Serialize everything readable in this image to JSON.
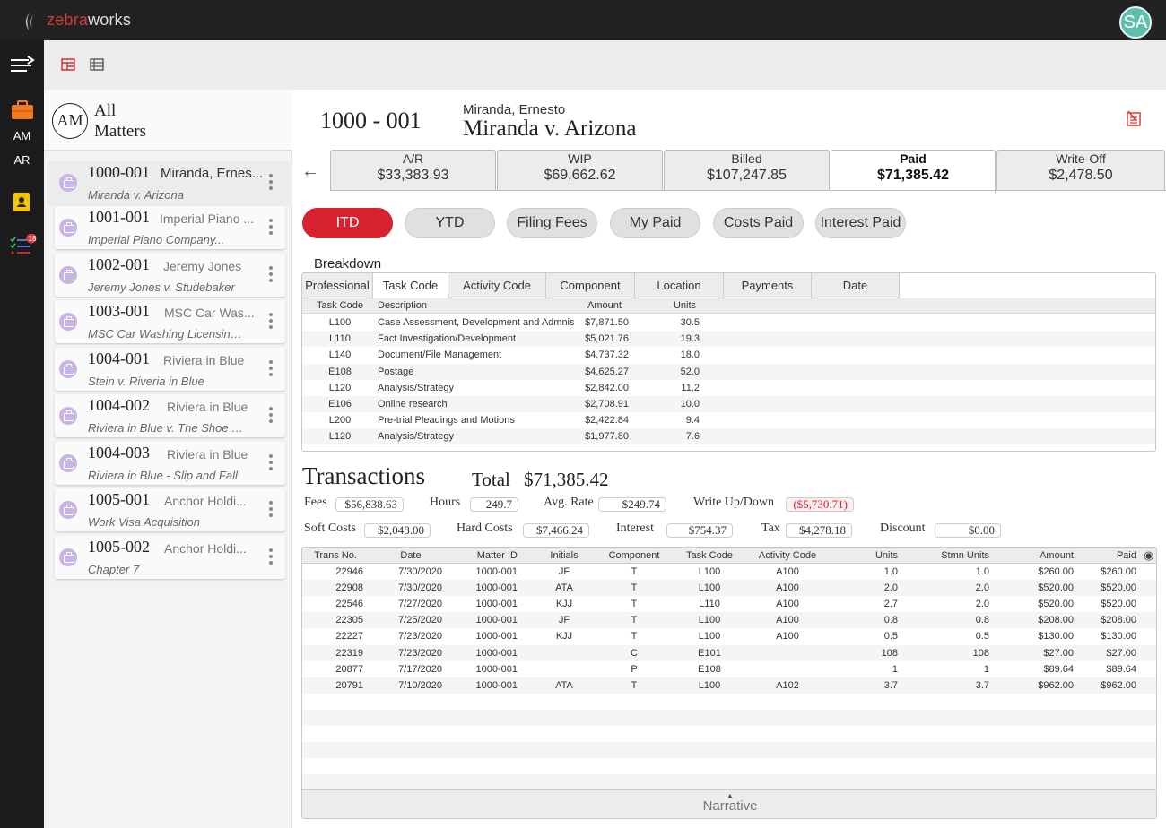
{
  "app": {
    "logo_part1": "zebra",
    "logo_part2": "works",
    "user_initials": "SA"
  },
  "rail": {
    "am_label": "AM",
    "ar_label": "AR",
    "task_badge": "18"
  },
  "sidebar": {
    "header_initials": "AM",
    "header_line1": "All",
    "header_line2": "Matters",
    "matters": [
      {
        "number": "1000-001",
        "client": "Miranda, Ernes...",
        "subtitle": "Miranda v. Arizona"
      },
      {
        "number": "1001-001",
        "client": "Imperial Piano ...",
        "subtitle": "Imperial Piano Company..."
      },
      {
        "number": "1002-001",
        "client": "Jeremy Jones",
        "subtitle": "Jeremy Jones v. Studebaker"
      },
      {
        "number": "1003-001",
        "client": "MSC Car Was...",
        "subtitle": "MSC Car Washing Licensing..."
      },
      {
        "number": "1004-001",
        "client": "Riviera in Blue",
        "subtitle": "Stein v. Riveria in Blue"
      },
      {
        "number": "1004-002",
        "client": "Riviera in Blue",
        "subtitle": "Riviera in Blue v. The Shoe Sto..."
      },
      {
        "number": "1004-003",
        "client": "Riviera in Blue",
        "subtitle": "Riviera in Blue - Slip and Fall"
      },
      {
        "number": "1005-001",
        "client": "Anchor Holdi...",
        "subtitle": "Work Visa Acquisition"
      },
      {
        "number": "1005-002",
        "client": "Anchor Holdi...",
        "subtitle": "Chapter 7"
      }
    ]
  },
  "matter": {
    "number": "1000 - 001",
    "client": "Miranda, Ernesto",
    "title": "Miranda v. Arizona"
  },
  "fin_tabs": [
    {
      "label": "A/R",
      "value": "$33,383.93"
    },
    {
      "label": "WIP",
      "value": "$69,662.62"
    },
    {
      "label": "Billed",
      "value": "$107,247.85"
    },
    {
      "label": "Paid",
      "value": "$71,385.42"
    },
    {
      "label": "Write-Off",
      "value": "$2,478.50"
    }
  ],
  "filters": [
    "ITD",
    "YTD",
    "Filing Fees",
    "My Paid",
    "Costs Paid",
    "Interest Paid"
  ],
  "breakdown": {
    "title": "Breakdown",
    "tabs": [
      "Professional",
      "Task Code",
      "Activity Code",
      "Component",
      "Location",
      "Payments",
      "Date"
    ],
    "columns": [
      "Task Code",
      "Description",
      "Amount",
      "Units"
    ],
    "rows": [
      [
        "L100",
        "Case Assessment, Development and Admnis",
        "$7,871.50",
        "30.5"
      ],
      [
        "L110",
        "Fact Investigation/Development",
        "$5,021.76",
        "19.3"
      ],
      [
        "L140",
        "Document/File Management",
        "$4,737.32",
        "18.0"
      ],
      [
        "E108",
        "Postage",
        "$4,625.27",
        "52.0"
      ],
      [
        "L120",
        "Analysis/Strategy",
        "$2,842.00",
        "11.2"
      ],
      [
        "E106",
        "Online research",
        "$2,708.91",
        "10.0"
      ],
      [
        "L200",
        "Pre-trial Pleadings and Motions",
        "$2,422.84",
        "9.4"
      ],
      [
        "L120",
        "Analysis/Strategy",
        "$1,977.80",
        "7.6"
      ]
    ]
  },
  "transactions": {
    "title": "Transactions",
    "total_label": "Total",
    "total": "$71,385.42",
    "summary": {
      "fees_label": "Fees",
      "fees": "$56,838.63",
      "hours_label": "Hours",
      "hours": "249.7",
      "avg_rate_label": "Avg. Rate",
      "avg_rate": "$249.74",
      "write_label": "Write Up/Down",
      "write": "($5,730.71)",
      "soft_label": "Soft Costs",
      "soft": "$2,048.00",
      "hard_label": "Hard Costs",
      "hard": "$7,466.24",
      "interest_label": "Interest",
      "interest": "$754.37",
      "tax_label": "Tax",
      "tax": "$4,278.18",
      "discount_label": "Discount",
      "discount": "$0.00"
    },
    "columns": [
      "Trans No.",
      "Date",
      "Matter ID",
      "Initials",
      "Component",
      "Task Code",
      "Activity Code",
      "Units",
      "Stmn Units",
      "Amount",
      "Paid"
    ],
    "rows": [
      [
        "22946",
        "7/30/2020",
        "1000-001",
        "JF",
        "T",
        "L100",
        "A100",
        "1.0",
        "1.0",
        "$260.00",
        "$260.00"
      ],
      [
        "22908",
        "7/30/2020",
        "1000-001",
        "ATA",
        "T",
        "L100",
        "A100",
        "2.0",
        "2.0",
        "$520.00",
        "$520.00"
      ],
      [
        "22546",
        "7/27/2020",
        "1000-001",
        "KJJ",
        "T",
        "L110",
        "A100",
        "2.7",
        "2.0",
        "$520.00",
        "$520.00"
      ],
      [
        "22305",
        "7/25/2020",
        "1000-001",
        "JF",
        "T",
        "L100",
        "A100",
        "0.8",
        "0.8",
        "$208.00",
        "$208.00"
      ],
      [
        "22227",
        "7/23/2020",
        "1000-001",
        "KJJ",
        "T",
        "L100",
        "A100",
        "0.5",
        "0.5",
        "$130.00",
        "$130.00"
      ],
      [
        "22319",
        "7/23/2020",
        "1000-001",
        "",
        "C",
        "E101",
        "",
        "108",
        "108",
        "$27.00",
        "$27.00"
      ],
      [
        "20877",
        "7/17/2020",
        "1000-001",
        "",
        "P",
        "E108",
        "",
        "1",
        "1",
        "$89.64",
        "$89.64"
      ],
      [
        "20791",
        "7/10/2020",
        "1000-001",
        "ATA",
        "T",
        "L100",
        "A102",
        "3.7",
        "3.7",
        "$962.00",
        "$962.00"
      ]
    ],
    "narrative_label": "Narrative"
  },
  "colors": {
    "accent": "#d6232f",
    "topbar": "#222222",
    "avatar": "#5fbfae",
    "matter_icon": "#c8b4e6"
  }
}
